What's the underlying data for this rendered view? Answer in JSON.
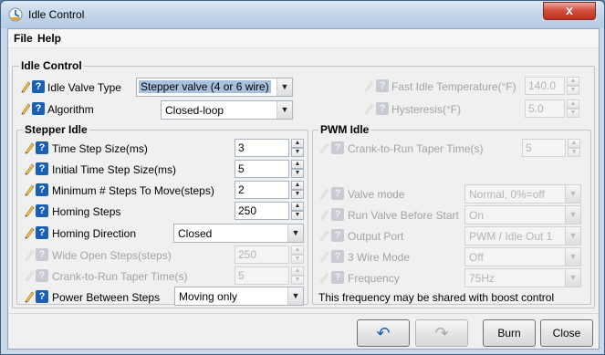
{
  "window": {
    "title": "Idle Control",
    "close_glyph": "x"
  },
  "menu": {
    "file": "File",
    "help": "Help"
  },
  "idle_control": {
    "legend": "Idle Control",
    "idle_valve_type": {
      "label": "Idle Valve Type",
      "value": "Stepper valve (4 or 6 wire)"
    },
    "algorithm": {
      "label": "Algorithm",
      "value": "Closed-loop"
    },
    "fast_idle_temp": {
      "label": "Fast Idle Temperature(°F)",
      "value": "140.0"
    },
    "hysteresis": {
      "label": "Hysteresis(°F)",
      "value": "5.0"
    }
  },
  "stepper_idle": {
    "legend": "Stepper Idle",
    "time_step_size": {
      "label": "Time Step Size(ms)",
      "value": "3"
    },
    "initial_time_step_size": {
      "label": "Initial Time Step Size(ms)",
      "value": "5"
    },
    "min_steps_to_move": {
      "label": "Minimum # Steps To Move(steps)",
      "value": "2"
    },
    "homing_steps": {
      "label": "Homing Steps",
      "value": "250"
    },
    "homing_direction": {
      "label": "Homing Direction",
      "value": "Closed"
    },
    "wide_open_steps": {
      "label": "Wide Open Steps(steps)",
      "value": "250"
    },
    "crank_to_run_taper": {
      "label": "Crank-to-Run Taper Time(s)",
      "value": "5"
    },
    "power_between_steps": {
      "label": "Power Between Steps",
      "value": "Moving only"
    }
  },
  "pwm_idle": {
    "legend": "PWM Idle",
    "crank_to_run_taper": {
      "label": "Crank-to-Run Taper Time(s)",
      "value": "5"
    },
    "valve_mode": {
      "label": "Valve mode",
      "value": "Normal, 0%=off"
    },
    "run_valve_before_start": {
      "label": "Run Valve Before Start",
      "value": "On"
    },
    "output_port": {
      "label": "Output Port",
      "value": "PWM / Idle Out 1"
    },
    "three_wire_mode": {
      "label": "3 Wire Mode",
      "value": "Off"
    },
    "frequency": {
      "label": "Frequency",
      "value": "75Hz"
    },
    "note": "This frequency may be shared with boost control"
  },
  "buttons": {
    "undo_icon": "↶",
    "redo_icon": "↷",
    "burn": "Burn",
    "close": "Close"
  },
  "colors": {
    "help_icon": "#1a5fb4",
    "disabled_text": "#a3a3a3",
    "title_bar": "#c3d6ea"
  }
}
